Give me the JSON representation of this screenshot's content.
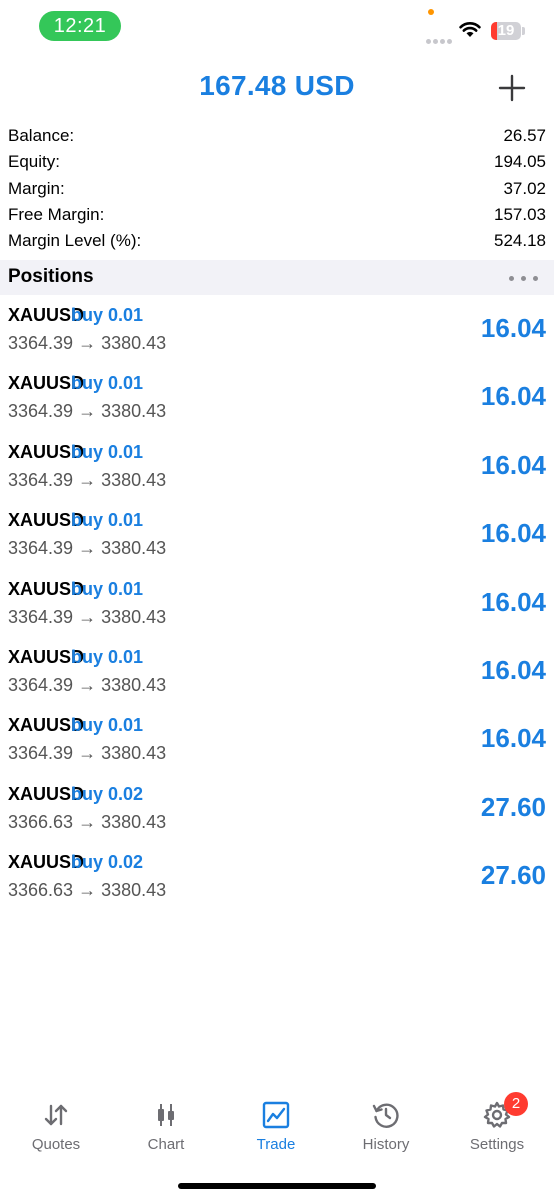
{
  "status_bar": {
    "time": "12:21",
    "battery_level": "19",
    "battery_fraction": 0.19,
    "icons": [
      "orange-indicator-dot",
      "cellular-signal-dots",
      "wifi-icon",
      "battery-icon"
    ]
  },
  "header": {
    "title": "167.48 USD",
    "add_icon": "plus-icon"
  },
  "account": {
    "rows": [
      {
        "label": "Balance:",
        "value": "26.57"
      },
      {
        "label": "Equity:",
        "value": "194.05"
      },
      {
        "label": "Margin:",
        "value": "37.02"
      },
      {
        "label": "Free Margin:",
        "value": "157.03"
      },
      {
        "label": "Margin Level (%):",
        "value": "524.18"
      }
    ]
  },
  "positions": {
    "title": "Positions",
    "more_icon": "ellipsis-icon",
    "items": [
      {
        "symbol": "XAUUSD",
        "side": "buy 0.01",
        "prices": "3364.39 → 3380.43",
        "profit": "16.04"
      },
      {
        "symbol": "XAUUSD",
        "side": "buy 0.01",
        "prices": "3364.39 → 3380.43",
        "profit": "16.04"
      },
      {
        "symbol": "XAUUSD",
        "side": "buy 0.01",
        "prices": "3364.39 → 3380.43",
        "profit": "16.04"
      },
      {
        "symbol": "XAUUSD",
        "side": "buy 0.01",
        "prices": "3364.39 → 3380.43",
        "profit": "16.04"
      },
      {
        "symbol": "XAUUSD",
        "side": "buy 0.01",
        "prices": "3364.39 → 3380.43",
        "profit": "16.04"
      },
      {
        "symbol": "XAUUSD",
        "side": "buy 0.01",
        "prices": "3364.39 → 3380.43",
        "profit": "16.04"
      },
      {
        "symbol": "XAUUSD",
        "side": "buy 0.01",
        "prices": "3364.39 → 3380.43",
        "profit": "16.04"
      },
      {
        "symbol": "XAUUSD",
        "side": "buy 0.02",
        "prices": "3366.63 → 3380.43",
        "profit": "27.60"
      },
      {
        "symbol": "XAUUSD",
        "side": "buy 0.02",
        "prices": "3366.63 → 3380.43",
        "profit": "27.60"
      }
    ]
  },
  "tabs": [
    {
      "label": "Quotes",
      "icon": "quotes-arrows-icon",
      "active": false
    },
    {
      "label": "Chart",
      "icon": "candlestick-chart-icon",
      "active": false
    },
    {
      "label": "Trade",
      "icon": "trade-line-chart-icon",
      "active": true
    },
    {
      "label": "History",
      "icon": "history-clock-icon",
      "active": false
    },
    {
      "label": "Settings",
      "icon": "gear-icon",
      "active": false,
      "badge": "2"
    }
  ],
  "colors": {
    "accent": "#1a7fe0",
    "status_pill": "#34c759",
    "badge": "#ff3b30",
    "section_bg": "#f2f2f7"
  }
}
